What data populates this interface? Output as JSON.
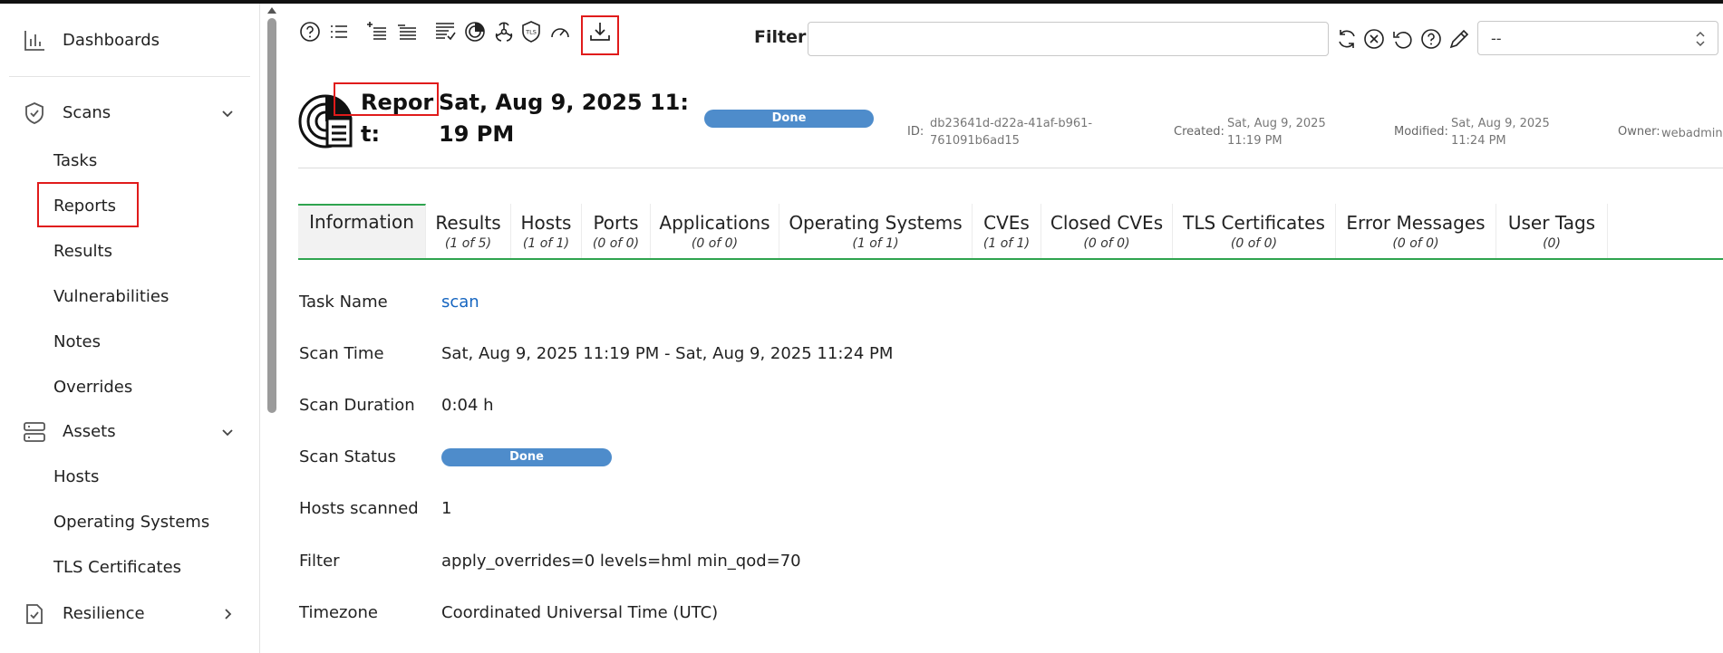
{
  "sidebar": {
    "dashboards": "Dashboards",
    "scans": {
      "label": "Scans",
      "items": [
        "Tasks",
        "Reports",
        "Results",
        "Vulnerabilities",
        "Notes",
        "Overrides"
      ]
    },
    "assets": {
      "label": "Assets",
      "items": [
        "Hosts",
        "Operating Systems",
        "TLS Certificates"
      ]
    },
    "resilience": "Resilience"
  },
  "toolbar": {
    "icons": [
      "help-icon",
      "list-icon",
      "new-list-icon",
      "list-alt-icon",
      "delta-report-icon",
      "cvss-icon",
      "hazard-icon",
      "tls-icon",
      "performance-icon",
      "download-icon"
    ]
  },
  "filter": {
    "label": "Filter",
    "value": "",
    "select_value": "--"
  },
  "report": {
    "title": "Report:",
    "date": "Sat, Aug 9, 2025 11:19 PM",
    "status": "Done",
    "id_label": "ID:",
    "id_value": "db23641d-d22a-41af-b961-761091b6ad15",
    "created_label": "Created:",
    "created_value": "Sat, Aug 9, 2025 11:19 PM",
    "modified_label": "Modified:",
    "modified_value": "Sat, Aug 9, 2025 11:24 PM",
    "owner_label": "Owner:",
    "owner_value": "webadmin"
  },
  "tabs": [
    {
      "name": "Information",
      "count": ""
    },
    {
      "name": "Results",
      "count": "(1 of 5)"
    },
    {
      "name": "Hosts",
      "count": "(1 of 1)"
    },
    {
      "name": "Ports",
      "count": "(0 of 0)"
    },
    {
      "name": "Applications",
      "count": "(0 of 0)"
    },
    {
      "name": "Operating Systems",
      "count": "(1 of 1)"
    },
    {
      "name": "CVEs",
      "count": "(1 of 1)"
    },
    {
      "name": "Closed CVEs",
      "count": "(0 of 0)"
    },
    {
      "name": "TLS Certificates",
      "count": "(0 of 0)"
    },
    {
      "name": "Error Messages",
      "count": "(0 of 0)"
    },
    {
      "name": "User Tags",
      "count": "(0)"
    }
  ],
  "info": {
    "task_name_label": "Task Name",
    "task_name_value": "scan",
    "scan_time_label": "Scan Time",
    "scan_time_value": "Sat, Aug 9, 2025 11:19 PM - Sat, Aug 9, 2025 11:24 PM",
    "scan_duration_label": "Scan Duration",
    "scan_duration_value": "0:04 h",
    "scan_status_label": "Scan Status",
    "scan_status_value": "Done",
    "hosts_scanned_label": "Hosts scanned",
    "hosts_scanned_value": "1",
    "filter_label": "Filter",
    "filter_value": "apply_overrides=0 levels=hml min_qod=70",
    "timezone_label": "Timezone",
    "timezone_value": "Coordinated Universal Time (UTC)"
  },
  "colors": {
    "status_done": "#4e8ccb",
    "tab_accent": "#2fa44f",
    "highlight": "#e01b1b",
    "link": "#1565c0"
  }
}
